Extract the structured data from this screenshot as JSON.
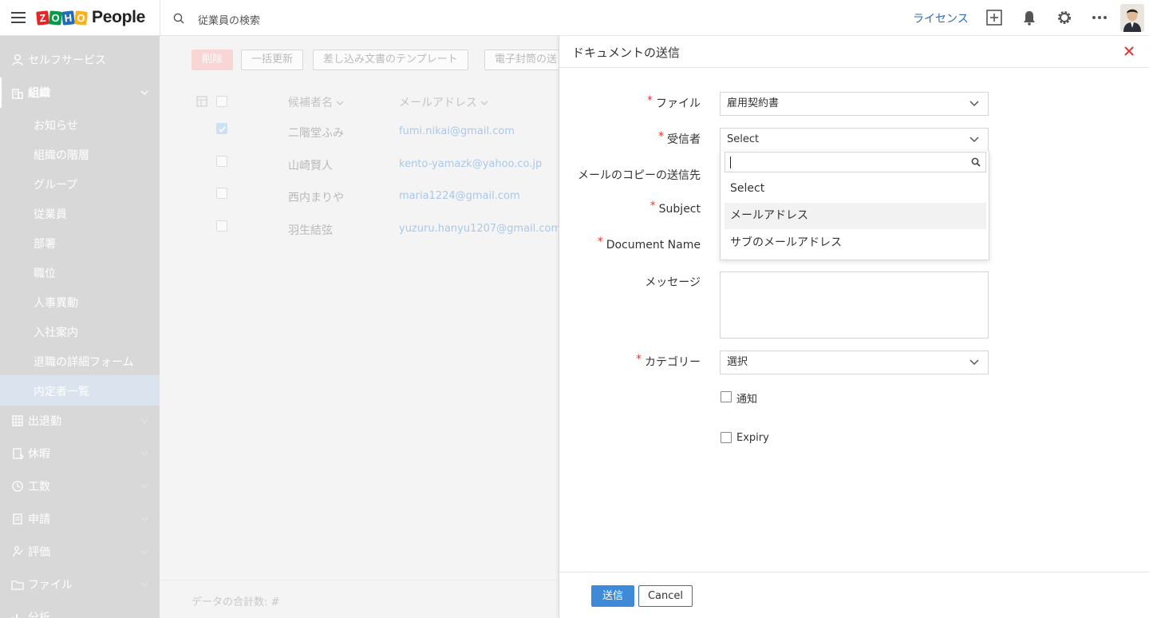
{
  "app": {
    "brand_letters": [
      "Z",
      "O",
      "H",
      "O"
    ],
    "brand_name": "People"
  },
  "topbar": {
    "search_placeholder": "従業員の検索",
    "license_label": "ライセンス"
  },
  "sidebar": {
    "self_service": "セルフサービス",
    "org": "組織",
    "sub_items": [
      "お知らせ",
      "組織の階層",
      "グループ",
      "従業員",
      "部署",
      "職位",
      "人事異動",
      "入社案内",
      "退職の詳細フォーム",
      "内定者一覧"
    ],
    "active_sub": "内定者一覧",
    "sections": [
      "出退勤",
      "休暇",
      "工数",
      "申請",
      "評価",
      "ファイル",
      "分析"
    ]
  },
  "main": {
    "buttons": {
      "delete": "削除",
      "bulk_update": "一括更新",
      "merge_template": "差し込み文書のテンプレート",
      "envelope": "電子封筒の送"
    },
    "columns": {
      "name": "候補者名",
      "email": "メールアドレス"
    },
    "rows": [
      {
        "name": "二階堂ふみ",
        "email": "fumi.nikai@gmail.com",
        "checked": true
      },
      {
        "name": "山崎賢人",
        "email": "kento-yamazk@yahoo.co.jp",
        "checked": false
      },
      {
        "name": "西内まりや",
        "email": "maria1224@gmail.com",
        "checked": false
      },
      {
        "name": "羽生結弦",
        "email": "yuzuru.hanyu1207@gmail.com",
        "checked": false
      }
    ],
    "footer": "データの合計数: #"
  },
  "drawer": {
    "title": "ドキュメントの送信",
    "required_mark": "*",
    "file_label": "ファイル",
    "file_value": "雇用契約書",
    "recipient_label": "受信者",
    "recipient_value": "Select",
    "cc_label": "メールのコピーの送信先",
    "subject_label": "Subject",
    "docname_label": "Document Name",
    "message_label": "メッセージ",
    "category_label": "カテゴリー",
    "category_value": "選択",
    "notify_label": "通知",
    "expiry_label": "Expiry",
    "send_label": "送信",
    "cancel_label": "Cancel",
    "dropdown_options": [
      "Select",
      "メールアドレス",
      "サブのメールアドレス"
    ],
    "dropdown_highlighted": "メールアドレス"
  },
  "colors": {
    "accent": "#3f8ad6",
    "required": "#e53935",
    "link": "#2c6db8"
  }
}
